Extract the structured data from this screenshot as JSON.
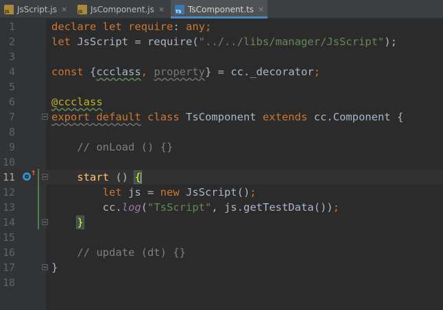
{
  "tabs": [
    {
      "label": "JsScript.js",
      "icon": "js-file-icon",
      "icon_text": "JS",
      "active": false,
      "close": "×"
    },
    {
      "label": "JsComponent.js",
      "icon": "js-file-icon",
      "icon_text": "JS",
      "active": false,
      "close": "×"
    },
    {
      "label": "TsComponent.ts",
      "icon": "ts-file-icon",
      "icon_text": "TS",
      "active": true,
      "close": "×"
    }
  ],
  "editor": {
    "current_line": 11,
    "line_numbers": [
      "1",
      "2",
      "3",
      "4",
      "5",
      "6",
      "7",
      "8",
      "9",
      "10",
      "11",
      "12",
      "13",
      "14",
      "15",
      "16",
      "17",
      "18"
    ],
    "lines": [
      [
        {
          "t": "declare let require",
          "c": "kw"
        },
        {
          "t": ": ",
          "c": ""
        },
        {
          "t": "any",
          "c": "kw"
        },
        {
          "t": ";",
          "c": "kw"
        }
      ],
      [
        {
          "t": "let ",
          "c": "kw"
        },
        {
          "t": "JsScript = require(",
          "c": ""
        },
        {
          "t": "\"../../libs/manager/JsScript\"",
          "c": "str"
        },
        {
          "t": ");",
          "c": ""
        }
      ],
      [],
      [
        {
          "t": "const ",
          "c": "kw"
        },
        {
          "t": "{",
          "c": ""
        },
        {
          "t": "ccclass",
          "c": "ul-green"
        },
        {
          "t": ", ",
          "c": "kw"
        },
        {
          "t": "property",
          "c": "dim ul-gray"
        },
        {
          "t": "} = cc._decorator",
          "c": ""
        },
        {
          "t": ";",
          "c": "kw"
        }
      ],
      [],
      [
        {
          "t": "@ccclass",
          "c": "dec ul-green"
        }
      ],
      [
        {
          "t": "export default",
          "c": "kw ul-gray"
        },
        {
          "t": " class ",
          "c": "kw"
        },
        {
          "t": "TsComponent ",
          "c": ""
        },
        {
          "t": "extends ",
          "c": "kw"
        },
        {
          "t": "cc.Component {",
          "c": ""
        }
      ],
      [],
      [
        {
          "t": "    // onLoad () {}",
          "c": "cmt"
        }
      ],
      [],
      [
        {
          "t": "    ",
          "c": ""
        },
        {
          "t": "start",
          "c": "fn"
        },
        {
          "t": " () ",
          "c": ""
        },
        {
          "t": "{",
          "c": "brace"
        }
      ],
      [
        {
          "t": "        let ",
          "c": "kw"
        },
        {
          "t": "js = ",
          "c": ""
        },
        {
          "t": "new ",
          "c": "kw"
        },
        {
          "t": "JsScript()",
          "c": ""
        },
        {
          "t": ";",
          "c": "kw"
        }
      ],
      [
        {
          "t": "        cc.",
          "c": ""
        },
        {
          "t": "log",
          "c": "prop italic"
        },
        {
          "t": "(",
          "c": ""
        },
        {
          "t": "\"TsScript\"",
          "c": "str"
        },
        {
          "t": ", js.getTestData())",
          "c": ""
        },
        {
          "t": ";",
          "c": "kw"
        }
      ],
      [
        {
          "t": "    ",
          "c": ""
        },
        {
          "t": "}",
          "c": "brace"
        }
      ],
      [],
      [
        {
          "t": "    // update (dt) {}",
          "c": "cmt"
        }
      ],
      [
        {
          "t": "}",
          "c": ""
        }
      ],
      []
    ]
  }
}
